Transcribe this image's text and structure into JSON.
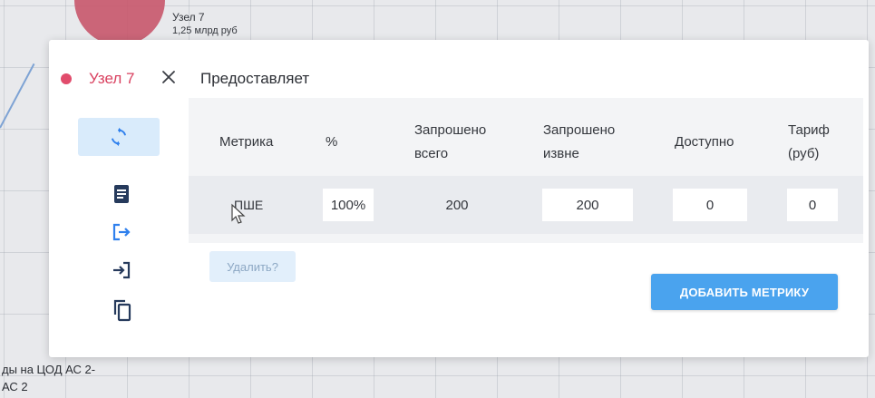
{
  "background": {
    "node_title": "Узел 7",
    "node_subtitle": "1,25 млрд руб",
    "caption_line1": "ды на ЦОД АС 2-",
    "caption_line2": "АС 2"
  },
  "modal": {
    "node_name": "Узел 7",
    "node_color": "#e14c6c",
    "section_title": "Предоставляет",
    "toolbar": {
      "icons": [
        "refresh-icon",
        "document-icon",
        "export-icon",
        "import-icon",
        "copy-icon"
      ],
      "active": "refresh-icon",
      "accent": "#2f80ed"
    },
    "table": {
      "headers": {
        "metric": "Метрика",
        "percent": "%",
        "requested_total_1": "Запрошено",
        "requested_total_2": "всего",
        "requested_external_1": "Запрошено",
        "requested_external_2": "извне",
        "available": "Доступно",
        "tariff_1": "Тариф",
        "tariff_2": "(руб)"
      },
      "rows": [
        {
          "metric": "ПШЕ",
          "percent": "100%",
          "requested_total": "200",
          "requested_external": "200",
          "available": "0",
          "tariff": "0"
        }
      ]
    },
    "delete_label": "Удалить?",
    "add_metric_label": "ДОБАВИТЬ МЕТРИКУ"
  }
}
